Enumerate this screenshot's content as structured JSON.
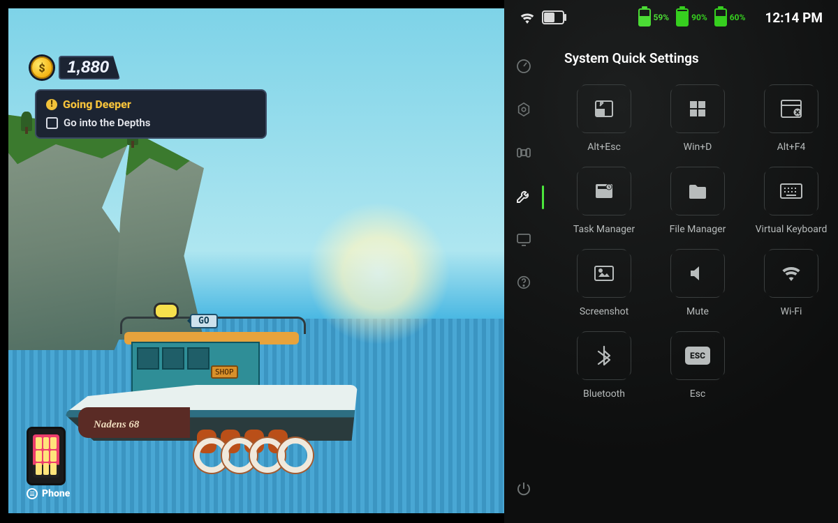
{
  "game": {
    "money": "1,880",
    "quest_title": "Going Deeper",
    "quest_sub": "Go into the Depths",
    "boat_name": "Nadens 68",
    "shop_sign": "SHOP",
    "go_badge": "GO",
    "phone_label": "Phone"
  },
  "status": {
    "battery_1": "59%",
    "battery_2": "90%",
    "battery_3": "60%",
    "time": "12:14 PM"
  },
  "panel": {
    "title": "System Quick Settings",
    "tiles": {
      "alt_esc": "Alt+Esc",
      "win_d": "Win+D",
      "alt_f4": "Alt+F4",
      "task_manager": "Task Manager",
      "file_manager": "File Manager",
      "virtual_keyboard": "Virtual Keyboard",
      "screenshot": "Screenshot",
      "mute": "Mute",
      "wifi": "Wi-Fi",
      "bluetooth": "Bluetooth",
      "esc": "Esc",
      "esc_icon_text": "ESC"
    }
  }
}
